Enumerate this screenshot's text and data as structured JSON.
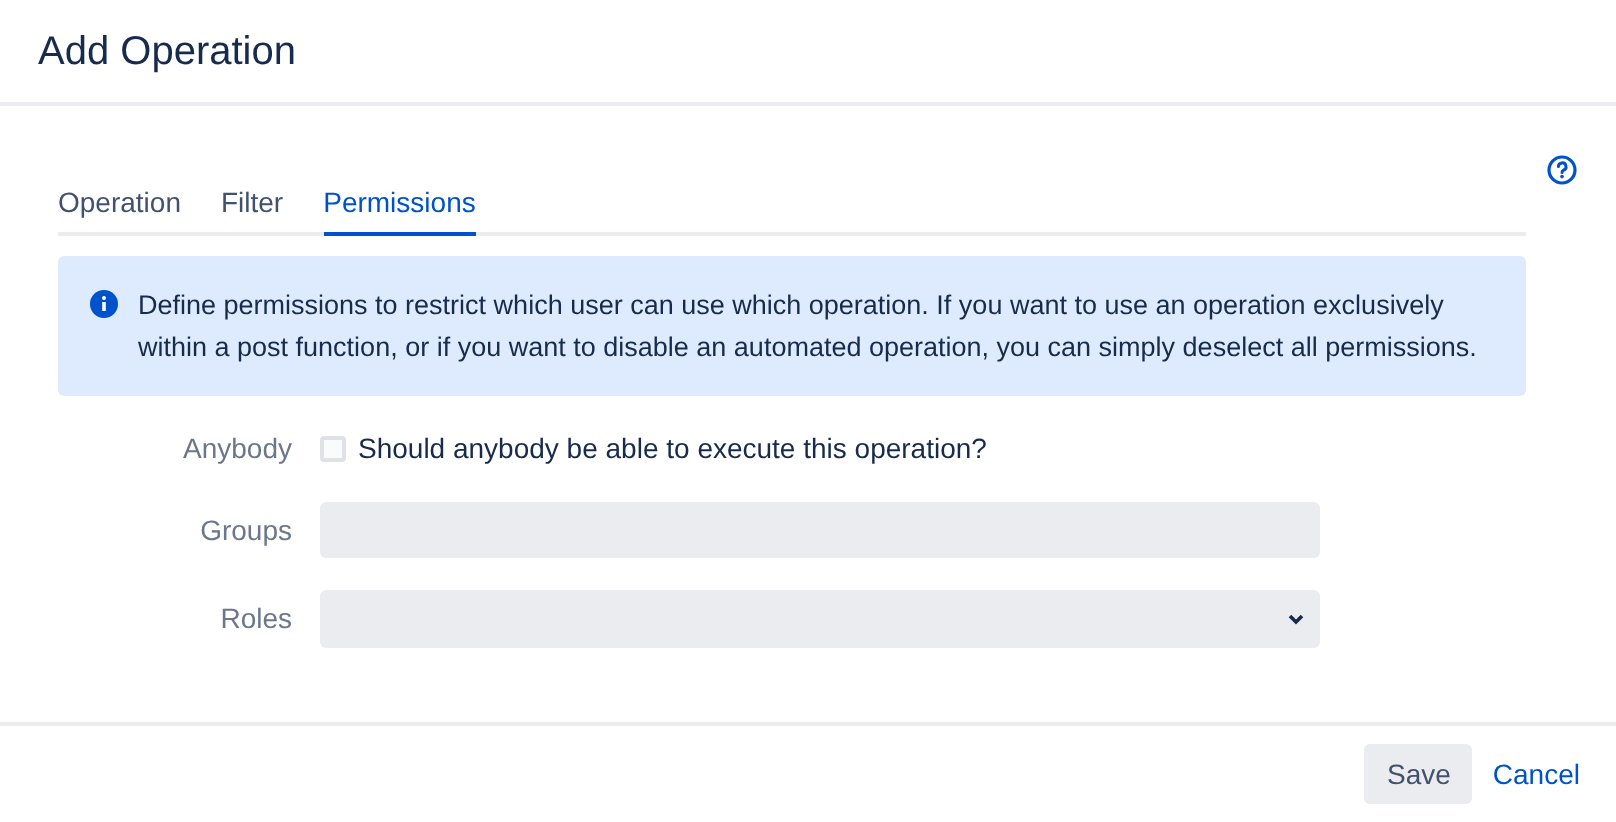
{
  "dialog": {
    "title": "Add Operation"
  },
  "tabs": [
    {
      "label": "Operation",
      "selected": false
    },
    {
      "label": "Filter",
      "selected": false
    },
    {
      "label": "Permissions",
      "selected": true
    }
  ],
  "info": {
    "text": "Define permissions to restrict which user can use which operation. If you want to use an operation exclusively within a post function, or if you want to disable an automated operation, you can simply deselect all permissions."
  },
  "fields": [
    {
      "kind": "checkbox",
      "label": "Anybody",
      "text": "Should anybody be able to execute this operation?",
      "checked": false
    },
    {
      "kind": "text",
      "label": "Groups"
    },
    {
      "kind": "select",
      "label": "Roles"
    }
  ],
  "buttons": [
    {
      "kind": "primary",
      "label": "Save"
    },
    {
      "kind": "link",
      "label": "Cancel"
    }
  ]
}
